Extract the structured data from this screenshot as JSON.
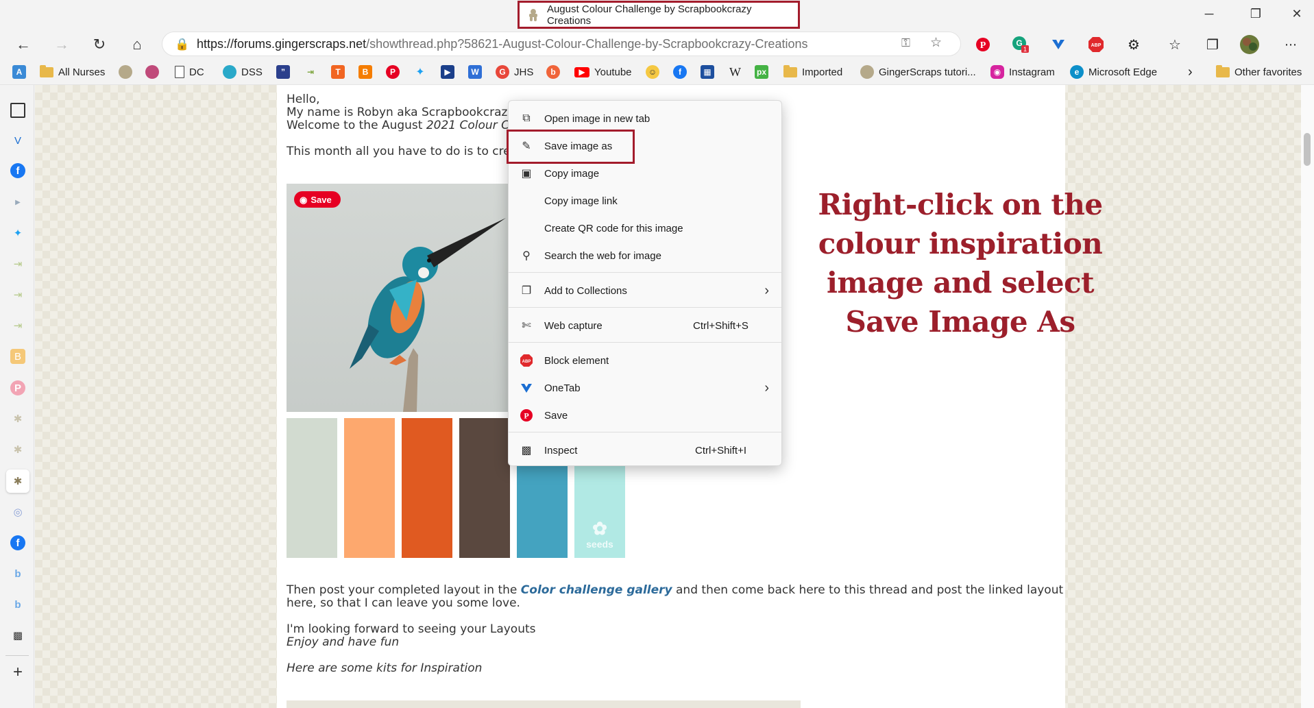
{
  "window": {
    "tab_title": "August Colour Challenge by Scrapbookcrazy Creations",
    "minimize": "─",
    "restore": "❐",
    "close": "✕"
  },
  "address": {
    "host": "https://forums.gingerscraps.net",
    "path": "/showthread.php?58621-August-Colour-Challenge-by-Scrapbookcrazy-Creations"
  },
  "favorites": [
    {
      "label": "All Nurses"
    },
    {
      "label": "DC"
    },
    {
      "label": "DSS"
    },
    {
      "label": "JHS"
    },
    {
      "label": "Youtube"
    },
    {
      "label": "W"
    },
    {
      "label": "Imported"
    },
    {
      "label": "GingerScraps tutori..."
    },
    {
      "label": "Instagram"
    },
    {
      "label": "Microsoft Edge"
    },
    {
      "label": "Other favorites"
    }
  ],
  "post": {
    "line1": "Hello,",
    "line2": "My name is Robyn aka Scrapbookcrazy",
    "line3_prefix": "Welcome to the August ",
    "line3_italic": "2021 Colour Ch",
    "line4": "This month all you have to do is to crea",
    "pin_save": "Save",
    "seeds": "seeds",
    "then_post_prefix": "Then post your completed layout in the ",
    "gallery_link": "Color challenge gallery",
    "then_post_suffix": " and then come back here to this thread and post the linked layout",
    "then_post_line2": "here, so that I can leave you some love.",
    "looking_forward": "I'm looking forward to seeing your Layouts",
    "enjoy": "Enjoy and have fun",
    "kits": "Here are some kits for Inspiration"
  },
  "swatches": [
    "#d2dbd0",
    "#fda86e",
    "#e05a21",
    "#5a483f",
    "#44a3c0",
    "#b1e9e4"
  ],
  "annotation": {
    "lines": [
      "Right-click on the",
      "colour inspiration",
      "image and select",
      "Save Image As"
    ]
  },
  "context_menu": {
    "items": [
      {
        "label": "Open image in new tab"
      },
      {
        "label": "Save image as"
      },
      {
        "label": "Copy image"
      },
      {
        "label": "Copy image link"
      },
      {
        "label": "Create QR code for this image"
      },
      {
        "label": "Search the web for image"
      },
      {
        "label": "Add to Collections"
      },
      {
        "label": "Web capture",
        "shortcut": "Ctrl+Shift+S"
      },
      {
        "label": "Block element"
      },
      {
        "label": "OneTab"
      },
      {
        "label": "Save"
      },
      {
        "label": "Inspect",
        "shortcut": "Ctrl+Shift+I"
      }
    ]
  },
  "colors": {
    "highlight": "#a31c2c",
    "annotation": "#9c1f2b",
    "pinterest": "#e60023"
  }
}
